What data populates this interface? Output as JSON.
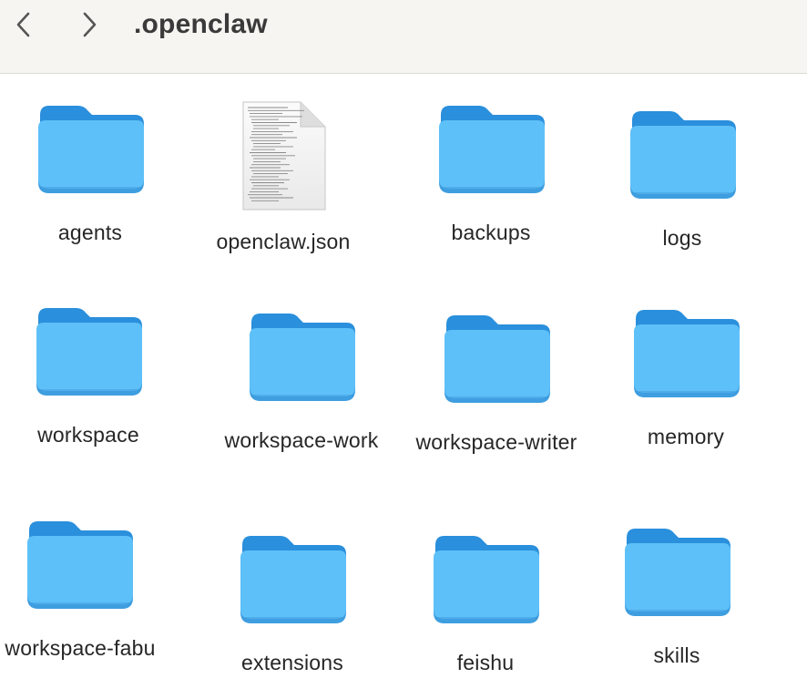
{
  "window": {
    "title": ".openclaw"
  },
  "toolbar": {
    "back_icon": "chevron-left-icon",
    "forward_icon": "chevron-right-icon"
  },
  "colors": {
    "folder_back": "#2a8fdc",
    "folder_front": "#5ec0f8",
    "folder_shadow": "#3e9ee0",
    "toolbar_bg": "#f7f5f2"
  },
  "items": [
    {
      "name": "agents",
      "kind": "folder",
      "icon": "folder-icon"
    },
    {
      "name": "openclaw.json",
      "kind": "file",
      "icon": "json-document-icon"
    },
    {
      "name": "backups",
      "kind": "folder",
      "icon": "folder-icon"
    },
    {
      "name": "logs",
      "kind": "folder",
      "icon": "folder-icon"
    },
    {
      "name": "workspace",
      "kind": "folder",
      "icon": "folder-icon"
    },
    {
      "name": "workspace-work",
      "kind": "folder",
      "icon": "folder-icon"
    },
    {
      "name": "workspace-writer",
      "kind": "folder",
      "icon": "folder-icon"
    },
    {
      "name": "memory",
      "kind": "folder",
      "icon": "folder-icon"
    },
    {
      "name": "workspace-fabu",
      "kind": "folder",
      "icon": "folder-icon"
    },
    {
      "name": "extensions",
      "kind": "folder",
      "icon": "folder-icon"
    },
    {
      "name": "feishu",
      "kind": "folder",
      "icon": "folder-icon"
    },
    {
      "name": "skills",
      "kind": "folder",
      "icon": "folder-icon"
    }
  ]
}
